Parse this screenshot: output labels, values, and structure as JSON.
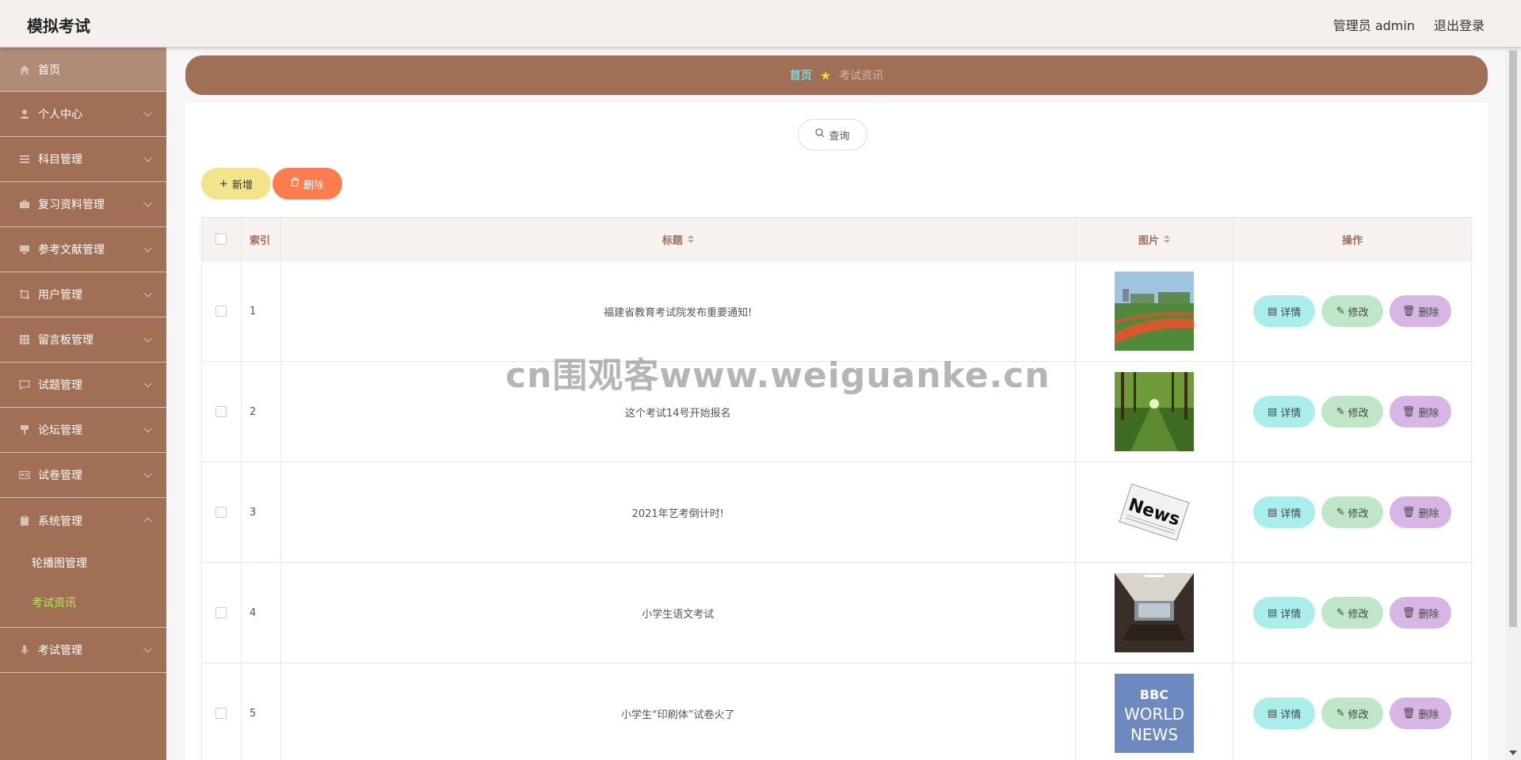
{
  "app": {
    "title": "模拟考试"
  },
  "header": {
    "user": "管理员 admin",
    "logout": "退出登录"
  },
  "sidebar": {
    "items": [
      {
        "label": "首页",
        "icon": "home-icon"
      },
      {
        "label": "个人中心",
        "icon": "user-icon"
      },
      {
        "label": "科目管理",
        "icon": "list-icon"
      },
      {
        "label": "复习资料管理",
        "icon": "briefcase-icon"
      },
      {
        "label": "参考文献管理",
        "icon": "monitor-icon"
      },
      {
        "label": "用户管理",
        "icon": "crop-icon"
      },
      {
        "label": "留言板管理",
        "icon": "grid-icon"
      },
      {
        "label": "试题管理",
        "icon": "chat-icon"
      },
      {
        "label": "论坛管理",
        "icon": "pin-icon"
      },
      {
        "label": "试卷管理",
        "icon": "id-card-icon"
      },
      {
        "label": "系统管理",
        "icon": "clipboard-icon"
      },
      {
        "label": "考试管理",
        "icon": "mic-icon"
      }
    ],
    "sub_items": [
      {
        "label": "轮播图管理"
      },
      {
        "label": "考试资讯"
      }
    ]
  },
  "breadcrumb": {
    "home": "首页",
    "current": "考试资讯"
  },
  "toolbar": {
    "search_label": "查询",
    "add_label": "新增",
    "delete_label": "删除"
  },
  "table": {
    "columns": {
      "index": "索引",
      "title": "标题",
      "image": "图片",
      "ops": "操作"
    },
    "rows": [
      {
        "index": "1",
        "title": "福建省教育考试院发布重要通知!",
        "image": "campus-track-photo"
      },
      {
        "index": "2",
        "title": "这个考试14号开始报名",
        "image": "tree-path-photo"
      },
      {
        "index": "3",
        "title": "2021年艺考倒计时!",
        "image": "news-paper-photo"
      },
      {
        "index": "4",
        "title": "小学生语文考试",
        "image": "meeting-room-photo"
      },
      {
        "index": "5",
        "title": "小学生“印刷体”试卷火了",
        "image": "bbc-world-news-photo"
      }
    ],
    "ops": {
      "detail": "详情",
      "edit": "修改",
      "remove": "删除"
    }
  },
  "bbc": {
    "line1": "BBC",
    "line2": "WORLD",
    "line3": "NEWS"
  },
  "news_text": "News",
  "watermark": "cn围观客www.weiguanke.cn",
  "colors": {
    "sidebar": "#a16f55",
    "accent_active": "#a6f04d",
    "breadcrumb_home": "#7ad7e0"
  }
}
